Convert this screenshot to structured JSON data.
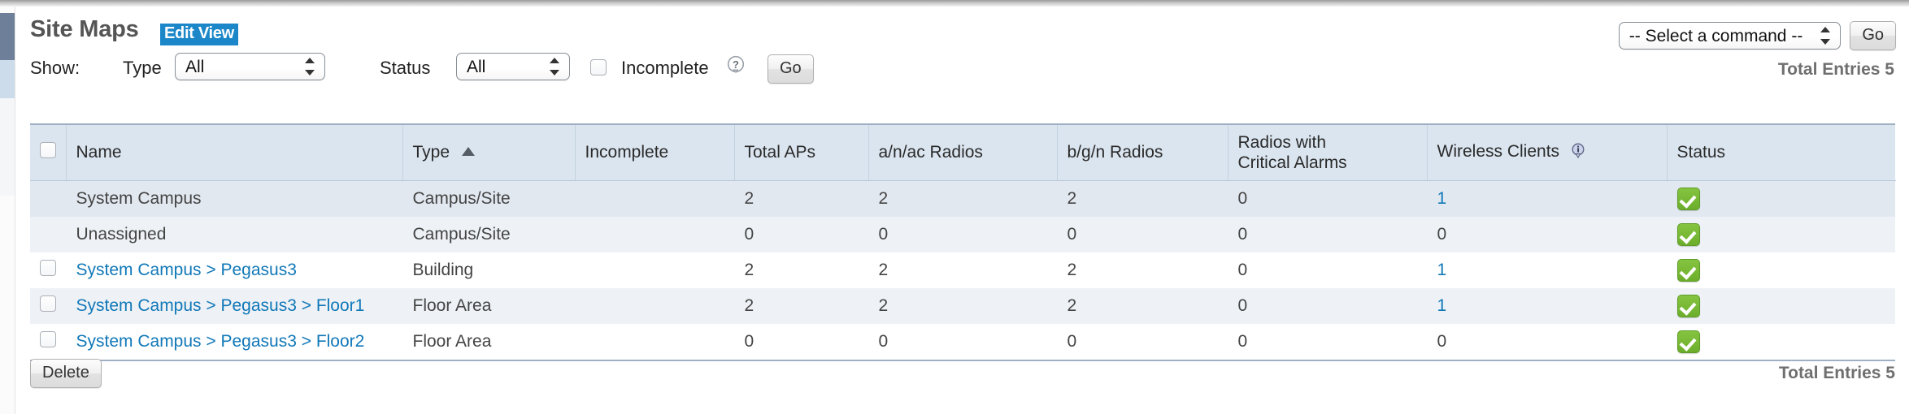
{
  "header": {
    "title": "Site Maps",
    "edit_view_label": "Edit View",
    "command_select_value": "-- Select a command --",
    "command_go_label": "Go"
  },
  "filters": {
    "show_label": "Show:",
    "type_label": "Type",
    "type_value": "All",
    "status_label": "Status",
    "status_value": "All",
    "incomplete_label": "Incomplete",
    "help_icon": "question-help-icon",
    "go_label": "Go"
  },
  "totals": {
    "top": "Total Entries 5",
    "bottom": "Total Entries 5"
  },
  "table": {
    "columns": [
      {
        "key": "check",
        "label": ""
      },
      {
        "key": "name",
        "label": "Name"
      },
      {
        "key": "type",
        "label": "Type",
        "sorted": "asc"
      },
      {
        "key": "incomplete",
        "label": "Incomplete"
      },
      {
        "key": "total_aps",
        "label": "Total APs"
      },
      {
        "key": "anac_radios",
        "label": "a/n/ac Radios"
      },
      {
        "key": "bgn_radios",
        "label": "b/g/n Radios"
      },
      {
        "key": "critical_alarms_line1",
        "label": "Radios with"
      },
      {
        "key": "critical_alarms_line2",
        "label": "Critical Alarms"
      },
      {
        "key": "wireless_clients",
        "label": "Wireless Clients"
      },
      {
        "key": "status",
        "label": "Status"
      }
    ],
    "rows": [
      {
        "selectable": false,
        "name": "System Campus",
        "name_is_link": false,
        "type": "Campus/Site",
        "incomplete": "",
        "total_aps": "2",
        "anac_radios": "2",
        "bgn_radios": "2",
        "critical_alarms": "0",
        "wireless_clients": "1",
        "clients_is_link": true,
        "status": "ok"
      },
      {
        "selectable": false,
        "name": "Unassigned",
        "name_is_link": false,
        "type": "Campus/Site",
        "incomplete": "",
        "total_aps": "0",
        "anac_radios": "0",
        "bgn_radios": "0",
        "critical_alarms": "0",
        "wireless_clients": "0",
        "clients_is_link": false,
        "status": "ok"
      },
      {
        "selectable": true,
        "name": "System Campus > Pegasus3",
        "name_is_link": true,
        "type": "Building",
        "incomplete": "",
        "total_aps": "2",
        "anac_radios": "2",
        "bgn_radios": "2",
        "critical_alarms": "0",
        "wireless_clients": "1",
        "clients_is_link": true,
        "status": "ok"
      },
      {
        "selectable": true,
        "name": "System Campus > Pegasus3 > Floor1",
        "name_is_link": true,
        "type": "Floor Area",
        "incomplete": "",
        "total_aps": "2",
        "anac_radios": "2",
        "bgn_radios": "2",
        "critical_alarms": "0",
        "wireless_clients": "1",
        "clients_is_link": true,
        "status": "ok"
      },
      {
        "selectable": true,
        "name": "System Campus > Pegasus3 > Floor2",
        "name_is_link": true,
        "type": "Floor Area",
        "incomplete": "",
        "total_aps": "0",
        "anac_radios": "0",
        "bgn_radios": "0",
        "critical_alarms": "0",
        "wireless_clients": "0",
        "clients_is_link": false,
        "status": "ok"
      }
    ]
  },
  "footer": {
    "delete_label": "Delete"
  },
  "colors": {
    "link": "#1178b8",
    "accent": "#1b87c9",
    "status_ok": "#6cae2b",
    "header_bg": "#dbe5ef"
  }
}
